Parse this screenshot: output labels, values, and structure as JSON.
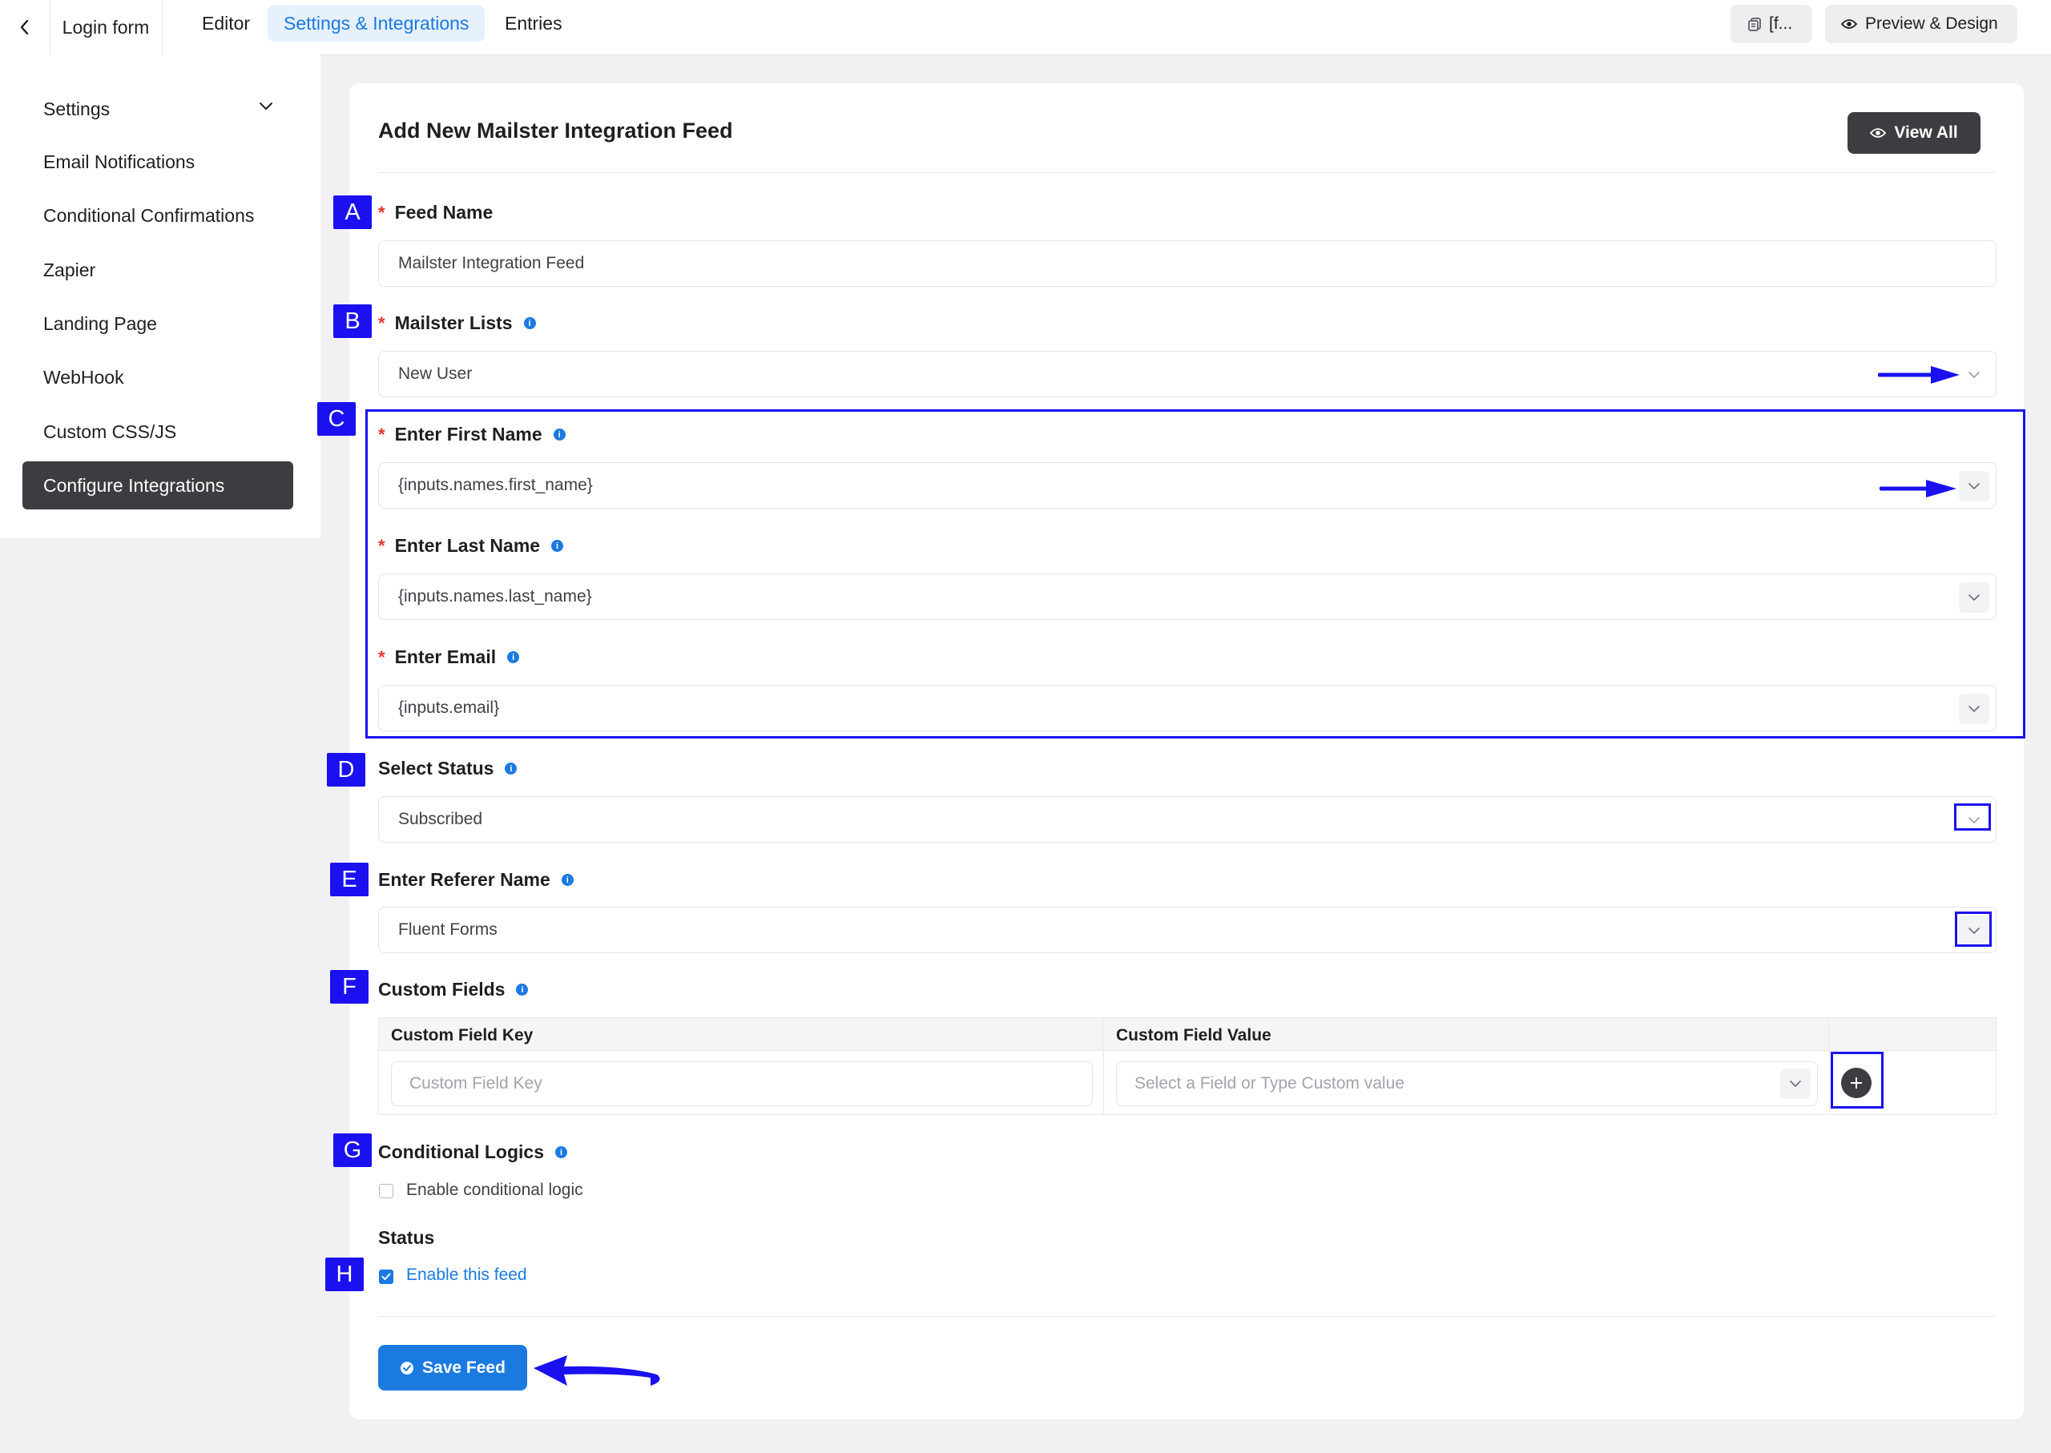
{
  "topbar": {
    "form_title": "Login form",
    "tabs": [
      {
        "label": "Editor"
      },
      {
        "label": "Settings & Integrations"
      },
      {
        "label": "Entries"
      }
    ],
    "shortcode_label": "[f...",
    "preview_label": "Preview & Design"
  },
  "sidebar": {
    "items": [
      {
        "label": "Settings"
      },
      {
        "label": "Email Notifications"
      },
      {
        "label": "Conditional Confirmations"
      },
      {
        "label": "Zapier"
      },
      {
        "label": "Landing Page"
      },
      {
        "label": "WebHook"
      },
      {
        "label": "Custom CSS/JS"
      },
      {
        "label": "Configure Integrations"
      }
    ]
  },
  "main": {
    "title": "Add New Mailster Integration Feed",
    "view_all_label": "View All",
    "feed_name": {
      "label": "Feed Name",
      "value": "Mailster Integration Feed"
    },
    "mailster_lists": {
      "label": "Mailster Lists",
      "value": "New User"
    },
    "first_name": {
      "label": "Enter First Name",
      "value": "{inputs.names.first_name}"
    },
    "last_name": {
      "label": "Enter Last Name",
      "value": "{inputs.names.last_name}"
    },
    "email": {
      "label": "Enter Email",
      "value": "{inputs.email}"
    },
    "select_status": {
      "label": "Select Status",
      "value": "Subscribed"
    },
    "referer_name": {
      "label": "Enter Referer Name",
      "value": "Fluent Forms"
    },
    "custom_fields": {
      "label": "Custom Fields",
      "key_header": "Custom Field Key",
      "value_header": "Custom Field Value",
      "key_placeholder": "Custom Field Key",
      "value_placeholder": "Select a Field or Type Custom value"
    },
    "conditional_logics": {
      "label": "Conditional Logics",
      "checkbox_label": "Enable conditional logic"
    },
    "status": {
      "label": "Status",
      "checkbox_label": "Enable this feed"
    },
    "save_label": "Save Feed"
  },
  "annotations": [
    "A",
    "B",
    "C",
    "D",
    "E",
    "F",
    "G",
    "H"
  ],
  "colors": {
    "accent": "#1a7ae0",
    "annotation": "#1a10f0",
    "dark_button": "#3b3d40",
    "required": "#e3342f"
  }
}
